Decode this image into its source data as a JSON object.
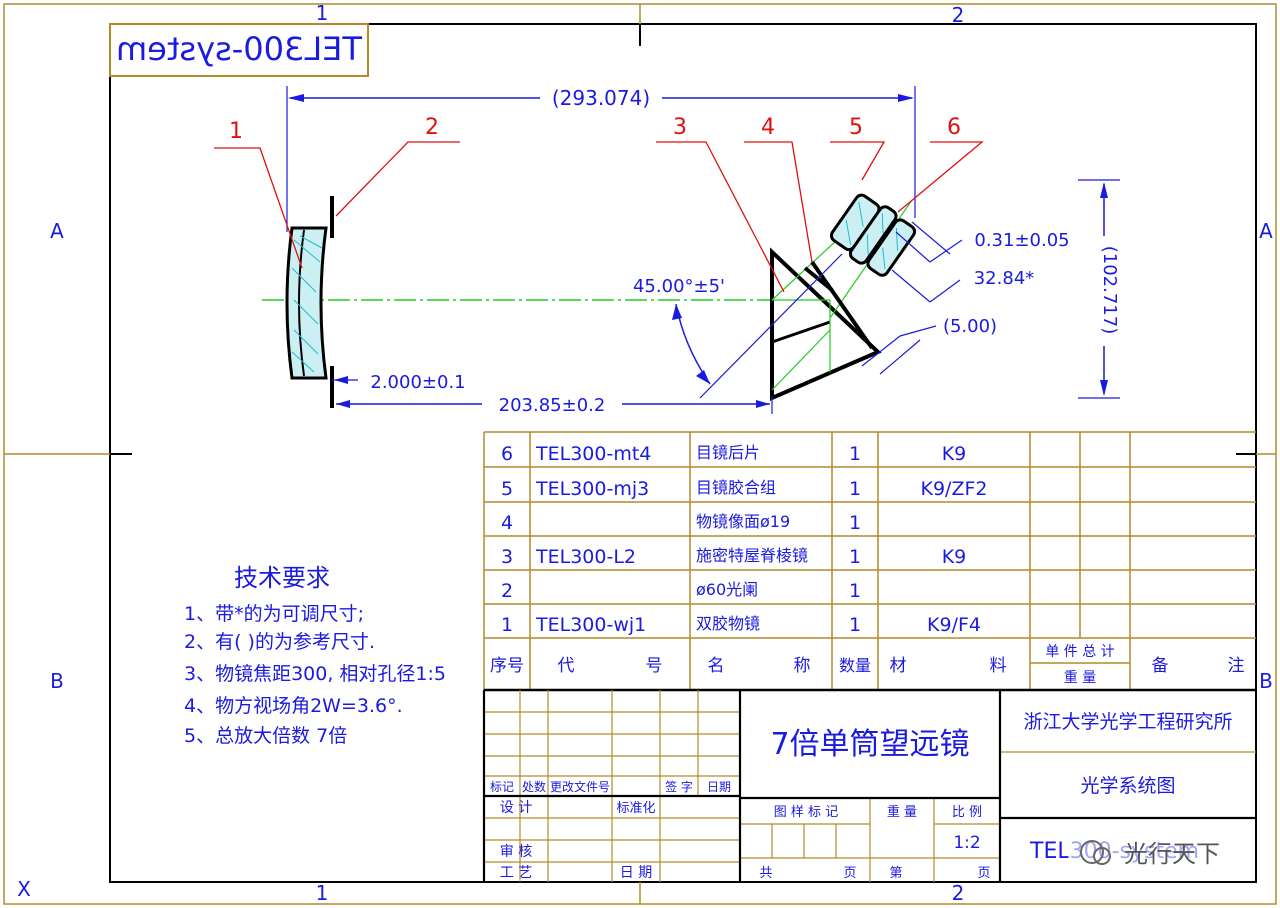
{
  "drawing_title_mirrored": "TEL300-system",
  "grid_labels": {
    "top": [
      "1",
      "2"
    ],
    "bottom": [
      "1",
      "2"
    ],
    "left": [
      "A",
      "B"
    ],
    "right": [
      "A",
      "B"
    ],
    "corner": "X"
  },
  "callouts": [
    "1",
    "2",
    "3",
    "4",
    "5",
    "6"
  ],
  "dimensions": {
    "overall_length": "(293.074)",
    "angle": "45.00°±5'",
    "thickness_top": "0.31±0.05",
    "adjustable": "32.84*",
    "reference": "(5.00)",
    "height": "(102.717)",
    "gap": "2.000±0.1",
    "base_length": "203.85±0.2"
  },
  "notes": {
    "heading": "技术要求",
    "items": [
      "1、带*的为可调尺寸;",
      "2、有( )的为参考尺寸.",
      "3、物镜焦距300, 相对孔径1:5",
      "4、物方视场角2W=3.6°.",
      "5、总放大倍数 7倍"
    ]
  },
  "parts": {
    "rows": [
      {
        "no": "6",
        "code": "TEL300-mt4",
        "name": "目镜后片",
        "qty": "1",
        "material": "K9"
      },
      {
        "no": "5",
        "code": "TEL300-mj3",
        "name": "目镜胶合组",
        "qty": "1",
        "material": "K9/ZF2"
      },
      {
        "no": "4",
        "code": "",
        "name": "物镜像面ø19",
        "qty": "1",
        "material": ""
      },
      {
        "no": "3",
        "code": "TEL300-L2",
        "name": "施密特屋脊棱镜",
        "qty": "1",
        "material": "K9"
      },
      {
        "no": "2",
        "code": "",
        "name": "ø60光阑",
        "qty": "1",
        "material": ""
      },
      {
        "no": "1",
        "code": "TEL300-wj1",
        "name": "双胶物镜",
        "qty": "1",
        "material": "K9/F4"
      }
    ],
    "headers": {
      "no": "序号",
      "code_a": "代",
      "code_b": "号",
      "name_a": "名",
      "name_b": "称",
      "qty": "数量",
      "mat_a": "材",
      "mat_b": "料",
      "weight_top": "单 件 总 计",
      "weight_bottom": "重    量",
      "remark_a": "备",
      "remark_b": "注"
    }
  },
  "title_block": {
    "product_name": "7倍单筒望远镜",
    "institute": "浙江大学光学工程研究所",
    "drawing_kind": "光学系统图",
    "drawing_no": "TEL300-system",
    "scale": "1:2",
    "rev_headers": [
      "标记",
      "处数",
      "更改文件号",
      "签 字",
      "日期"
    ],
    "design": "设 计",
    "standard": "标准化",
    "review": "审 核",
    "process": "工 艺",
    "date": "日 期",
    "stage_mark": "图 样 标 记",
    "weight": "重 量",
    "ratio": "比 例",
    "sheets": "共",
    "sheet_unit": "页",
    "sheet_no": "第",
    "sheet_no_unit": "页"
  },
  "watermark": "光行天下",
  "colors": {
    "frame": "#b48a2a",
    "dimension": "#1a1ae0",
    "leader": "#e01010",
    "axis": "#22cc22",
    "glass": "#22bbcc"
  }
}
